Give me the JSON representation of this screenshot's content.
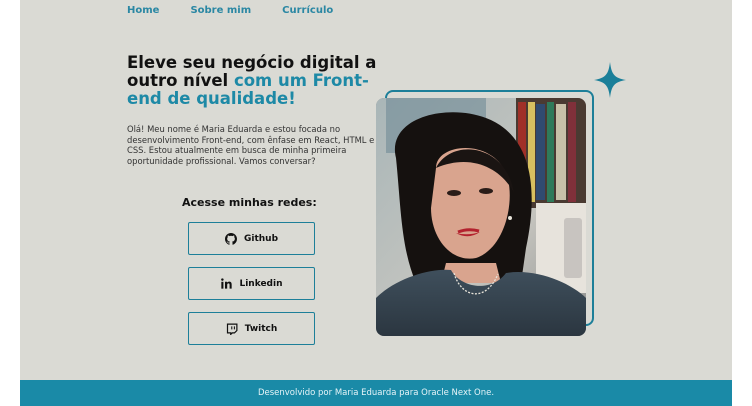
{
  "nav": {
    "home": "Home",
    "about": "Sobre mim",
    "cv": "Currículo"
  },
  "hero": {
    "headline_plain": "Eleve seu negócio digital a outro nível ",
    "headline_accent": "com um Front-end de qualidade!",
    "intro": "Olá! Meu nome é Maria Eduarda e estou focada no desenvolvimento Front-end, com ênfase em React, HTML e CSS. Estou atualmente em busca de minha primeira oportunidade profissional. Vamos conversar?"
  },
  "social": {
    "title": "Acesse minhas redes:",
    "github": {
      "label": "Github",
      "icon": "github-icon"
    },
    "linkedin": {
      "label": "Linkedin",
      "icon": "linkedin-icon"
    },
    "twitch": {
      "label": "Twitch",
      "icon": "twitch-icon"
    }
  },
  "footer": {
    "text": "Desenvolvido por Maria Eduarda para Oracle Next One."
  },
  "colors": {
    "accent": "#1d89a6",
    "background": "#dadad4",
    "footer": "#1a8aa7"
  }
}
